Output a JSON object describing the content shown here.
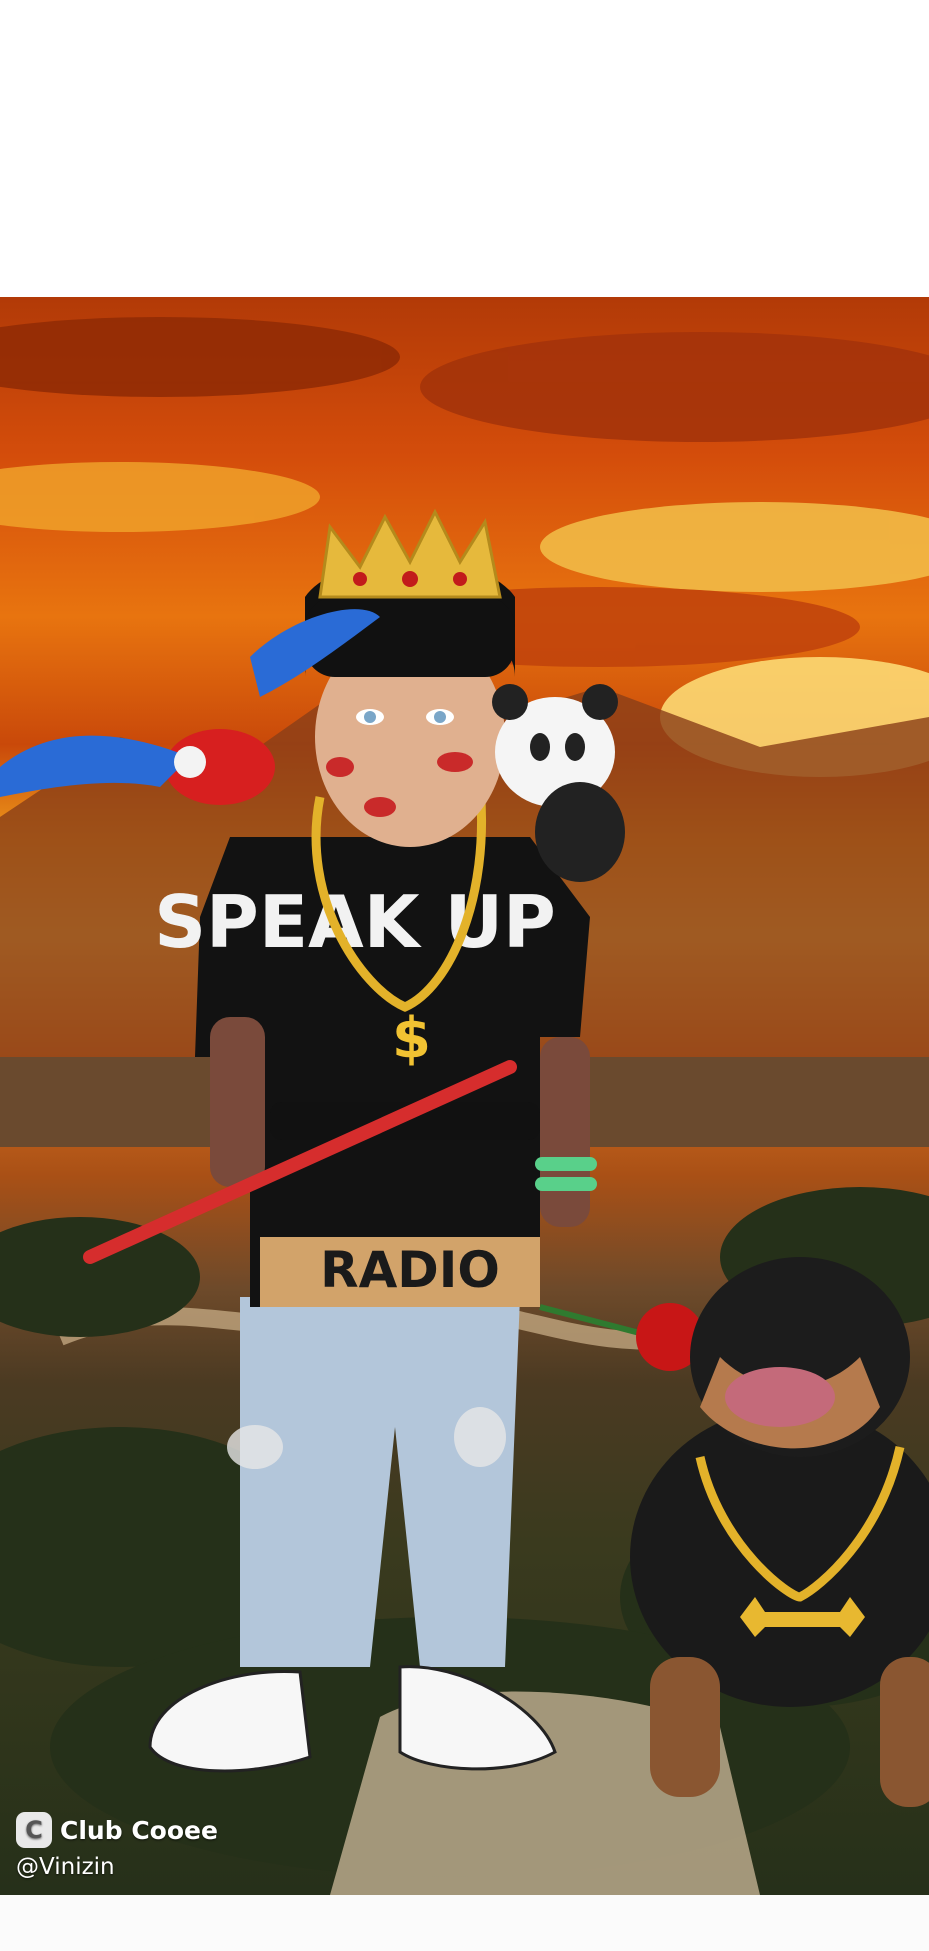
{
  "watermark": {
    "brand": "Club Cooee",
    "logo_glyph": "C",
    "handle": "@Vinizin"
  },
  "shirt": {
    "text_front": "SPEAK UP",
    "text_bottom": "RADIO"
  },
  "colors": {
    "sky_top": "#b23a07",
    "sun_glow": "#f6c94d",
    "ground": "#2f351b"
  },
  "icons": [
    "club-cooee-logo-icon"
  ]
}
